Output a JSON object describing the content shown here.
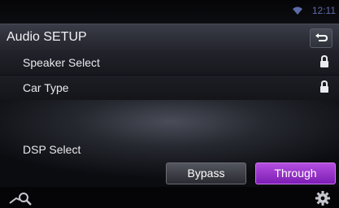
{
  "status": {
    "time": "12:11",
    "wifi_icon": "wifi-icon"
  },
  "header": {
    "title": "Audio SETUP",
    "back_icon": "back-return-icon"
  },
  "rows": [
    {
      "label": "Speaker Select",
      "lock_icon": "lock-icon"
    },
    {
      "label": "Car Type",
      "lock_icon": "lock-icon"
    }
  ],
  "dsp": {
    "label": "DSP Select",
    "options": [
      "Bypass",
      "Through"
    ],
    "selected": "Through",
    "accent": "#9b32d0"
  },
  "footer": {
    "search_icon": "search-icon",
    "settings_icon": "gear-icon"
  }
}
